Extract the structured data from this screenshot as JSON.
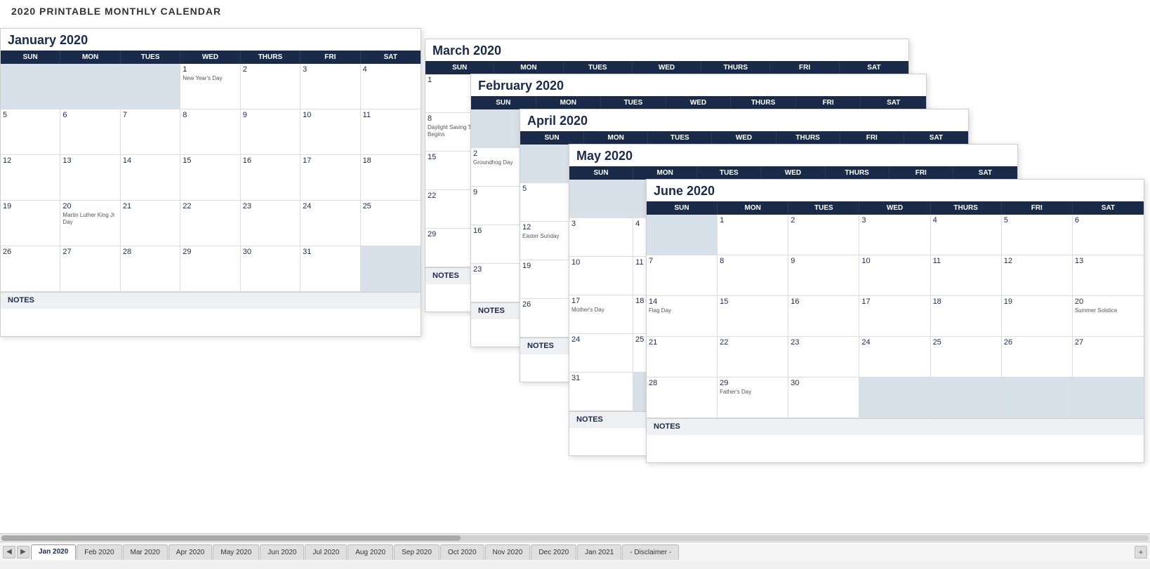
{
  "app": {
    "title": "2020 PRINTABLE MONTHLY CALENDAR"
  },
  "tabs": [
    {
      "label": "Jan 2020",
      "active": true
    },
    {
      "label": "Feb 2020",
      "active": false
    },
    {
      "label": "Mar 2020",
      "active": false
    },
    {
      "label": "Apr 2020",
      "active": false
    },
    {
      "label": "May 2020",
      "active": false
    },
    {
      "label": "Jun 2020",
      "active": false
    },
    {
      "label": "Jul 2020",
      "active": false
    },
    {
      "label": "Aug 2020",
      "active": false
    },
    {
      "label": "Sep 2020",
      "active": false
    },
    {
      "label": "Oct 2020",
      "active": false
    },
    {
      "label": "Nov 2020",
      "active": false
    },
    {
      "label": "Dec 2020",
      "active": false
    },
    {
      "label": "Jan 2021",
      "active": false
    },
    {
      "label": "- Disclaimer -",
      "active": false
    }
  ],
  "calendars": {
    "january": {
      "title": "January 2020",
      "days": [
        "SUN",
        "MON",
        "TUES",
        "WED",
        "THURS",
        "FRI",
        "SAT"
      ],
      "notes_label": "NOTES"
    },
    "march": {
      "title": "March 2020",
      "days": [
        "SUN",
        "MON",
        "TUES",
        "WED",
        "THURS",
        "FRI",
        "SAT"
      ],
      "notes_label": "NOTES"
    },
    "february": {
      "title": "February 2020",
      "days": [
        "SUN",
        "MON",
        "TUES",
        "WED",
        "THURS",
        "FRI",
        "SAT"
      ],
      "notes_label": "NOTES"
    },
    "april": {
      "title": "April 2020",
      "days": [
        "SUN",
        "MON",
        "TUES",
        "WED",
        "THURS",
        "FRI",
        "SAT"
      ],
      "notes_label": "NOTES"
    },
    "may": {
      "title": "May 2020",
      "days": [
        "SUN",
        "MON",
        "TUES",
        "WED",
        "THURS",
        "FRI",
        "SAT"
      ],
      "notes_label": "NOTES"
    },
    "june": {
      "title": "June 2020",
      "days": [
        "SUN",
        "MON",
        "TUES",
        "WED",
        "THURS",
        "FRI",
        "SAT"
      ],
      "notes_label": "NOTES"
    }
  }
}
